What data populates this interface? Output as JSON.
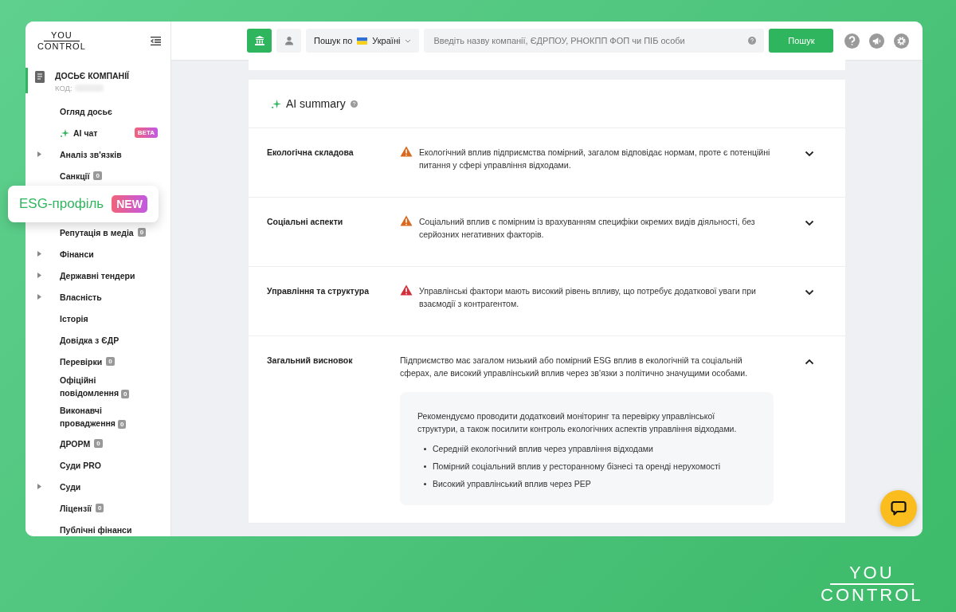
{
  "sidebar": {
    "logo": {
      "line_1": "YOU",
      "line_2": "CONTROL"
    },
    "section": {
      "title": "ДОСЬЄ КОМПАНІЇ",
      "code_label": "КОД:"
    },
    "items": [
      {
        "label": "Огляд досьє",
        "kind": "plain",
        "expandable": false
      },
      {
        "label": "AI чат",
        "kind": "ai",
        "expandable": false,
        "badge": "BETA"
      },
      {
        "label": "Аналіз зв'язків",
        "kind": "plain",
        "expandable": true
      },
      {
        "label": "Санкції",
        "kind": "plain",
        "expandable": false,
        "count": "0"
      },
      {
        "label": "ESG-профіль",
        "kind": "highlight",
        "badge": "NEW"
      },
      {
        "label": "Репутація в медіа",
        "kind": "plain",
        "expandable": false,
        "count": "0"
      },
      {
        "label": "Фінанси",
        "kind": "plain",
        "expandable": true
      },
      {
        "label": "Державні тендери",
        "kind": "plain",
        "expandable": true
      },
      {
        "label": "Власність",
        "kind": "plain",
        "expandable": true
      },
      {
        "label": "Історія",
        "kind": "plain",
        "expandable": false
      },
      {
        "label": "Довідка з ЄДР",
        "kind": "plain",
        "expandable": false
      },
      {
        "label": "Перевірки",
        "kind": "plain",
        "expandable": false,
        "count": "0"
      },
      {
        "label": "Офіційні повідомлення",
        "kind": "plain",
        "expandable": false,
        "count": "0"
      },
      {
        "label": "Виконавчі провадження",
        "kind": "plain",
        "expandable": false,
        "count": "0"
      },
      {
        "label": "ДРОРМ",
        "kind": "plain",
        "expandable": false,
        "count": "0"
      },
      {
        "label": "Суди PRO",
        "kind": "plain",
        "expandable": false
      },
      {
        "label": "Суди",
        "kind": "plain",
        "expandable": true
      },
      {
        "label": "Ліцензії",
        "kind": "plain",
        "expandable": false,
        "count": "0"
      },
      {
        "label": "Публічні фінанси",
        "kind": "plain",
        "expandable": false
      }
    ]
  },
  "topbar": {
    "search_modes": [
      {
        "kind": "company",
        "selected": true
      },
      {
        "kind": "person",
        "selected": false
      }
    ],
    "country": {
      "label": "Пошук по",
      "value": "Україні"
    },
    "search": {
      "placeholder": "Введіть назву компанії, ЄДРПОУ, РНОКПП ФОП чи ПІБ особи"
    },
    "search_button": "Пошук"
  },
  "summary": {
    "title": "AI summary",
    "rows": [
      {
        "label": "Екологічна складова",
        "color": "#d9691f",
        "text": "Екологічний вплив підприємства помірний, загалом відповідає нормам, проте є потенційні питання у сфері управління відходами.",
        "expanded": false
      },
      {
        "label": "Соціальні аспекти",
        "color": "#d9691f",
        "text": "Соціальний вплив є помірним із врахуванням специфіки окремих видів діяльності, без серйозних негативних факторів.",
        "expanded": false
      },
      {
        "label": "Управління та структура",
        "color": "#d32f3a",
        "text": "Управлінські фактори мають високий рівень впливу, що потребує додаткової уваги при взаємодії з контрагентом.",
        "expanded": false
      },
      {
        "label": "Загальний висновок",
        "text": "Підприємство має загалом низький або помірний ESG вплив в екологічній та соціальній сферах, але високий управлінський вплив через зв'язки з політично значущими особами.",
        "expanded": true,
        "details": {
          "text": "Рекомендуємо проводити додатковий моніторинг та перевірку управлінської структури, а також посилити контроль екологічних аспектів управління відходами.",
          "bullets": [
            "Середній екологічний вплив через управління відходами",
            "Помірний соціальний вплив у ресторанному бізнесі та оренді нерухомості",
            "Високий управлінський вплив через PEP"
          ]
        }
      }
    ]
  },
  "brand": {
    "line_1": "YOU",
    "line_2": "CONTROL"
  }
}
